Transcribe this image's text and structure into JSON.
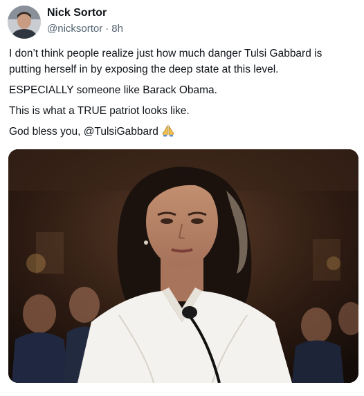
{
  "post": {
    "author_name": "Nick Sortor",
    "handle": "@nicksortor",
    "separator": "·",
    "time_ago": "8h",
    "paragraphs": [
      "I don’t think people realize just how much danger Tulsi Gabbard is putting herself in by exposing the deep state at this level.",
      "ESPECIALLY someone like Barack Obama.",
      "This is what a TRUE patriot looks like.",
      "God bless you, @TulsiGabbard"
    ],
    "emoji": "praying-hands-icon"
  },
  "colors": {
    "text_primary": "#0f1419",
    "text_secondary": "#536471",
    "blazer": "#f4f2ee",
    "background": "#ffffff"
  }
}
